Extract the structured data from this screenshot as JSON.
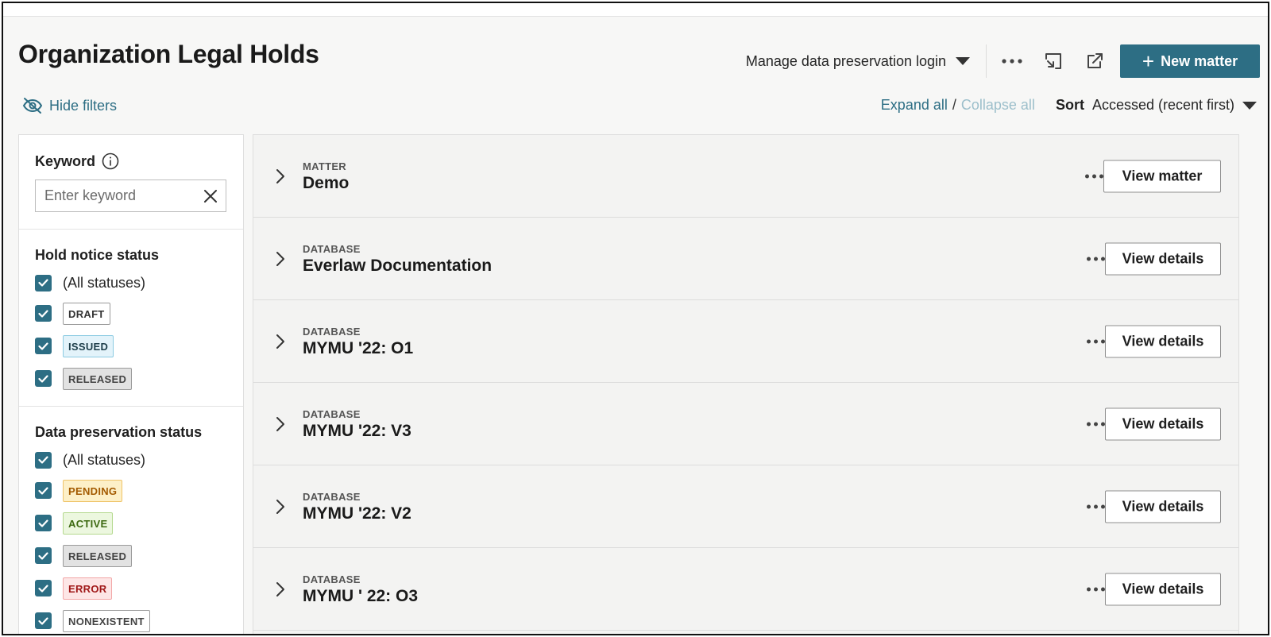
{
  "page": {
    "title": "Organization Legal Holds"
  },
  "header": {
    "manage_label": "Manage data preservation login",
    "new_matter_label": "New matter"
  },
  "filters_toggle": "Hide filters",
  "controls": {
    "expand_all": "Expand all",
    "separator": "/",
    "collapse_all": "Collapse all",
    "sort_label": "Sort",
    "sort_value": "Accessed (recent first)"
  },
  "filters": {
    "keyword": {
      "label": "Keyword",
      "placeholder": "Enter keyword"
    },
    "hold_notice": {
      "title": "Hold notice status",
      "all_label": "(All statuses)",
      "options": [
        "DRAFT",
        "ISSUED",
        "RELEASED"
      ]
    },
    "data_preservation": {
      "title": "Data preservation status",
      "all_label": "(All statuses)",
      "options": [
        "PENDING",
        "ACTIVE",
        "RELEASED",
        "ERROR",
        "NONEXISTENT"
      ]
    }
  },
  "rows": [
    {
      "type": "MATTER",
      "name": "Demo",
      "button": "View matter"
    },
    {
      "type": "DATABASE",
      "name": "Everlaw Documentation",
      "button": "View details"
    },
    {
      "type": "DATABASE",
      "name": "MYMU '22: O1",
      "button": "View details"
    },
    {
      "type": "DATABASE",
      "name": "MYMU '22: V3",
      "button": "View details"
    },
    {
      "type": "DATABASE",
      "name": "MYMU '22: V2",
      "button": "View details"
    },
    {
      "type": "DATABASE",
      "name": "MYMU ' 22: O3",
      "button": "View details"
    }
  ],
  "colors": {
    "accent": "#2d6e84",
    "accent_light": "#9cbfcb"
  },
  "icons": [
    "chevron-down-icon",
    "more-icon",
    "import-icon",
    "external-link-icon",
    "plus-icon",
    "eye-off-icon",
    "info-icon",
    "clear-icon",
    "checkbox-checked-icon",
    "chevron-right-icon"
  ]
}
